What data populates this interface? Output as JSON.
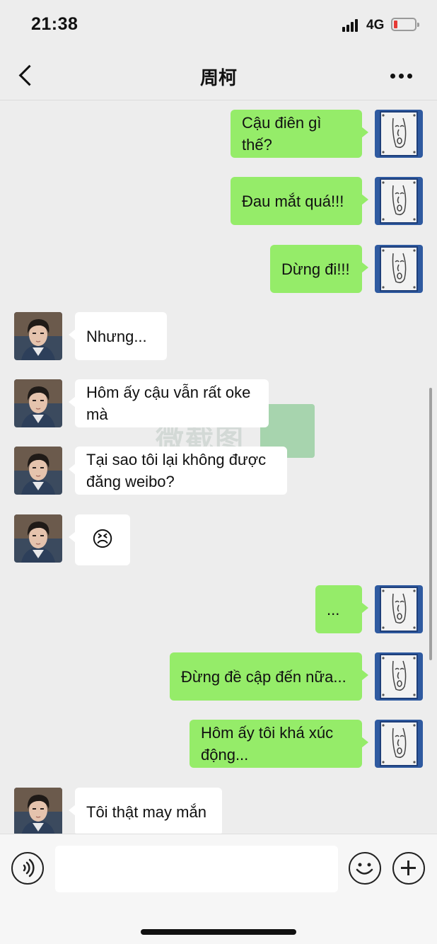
{
  "status_bar": {
    "time": "21:38",
    "network": "4G",
    "battery_color": "#e53935"
  },
  "nav": {
    "title": "周柯"
  },
  "messages": [
    {
      "from": "me",
      "text": "Cậu điên  gì thế?"
    },
    {
      "from": "me",
      "text": "Đau mắt quá!!!"
    },
    {
      "from": "me",
      "text": "Dừng đi!!!"
    },
    {
      "from": "them",
      "text": "Nhưng..."
    },
    {
      "from": "them",
      "text": "Hôm ấy cậu vẫn rất oke\nmà"
    },
    {
      "from": "them",
      "text": "Tại sao tôi lại không được\nđăng weibo?"
    },
    {
      "from": "them",
      "text": "😣",
      "is_emoji": true
    },
    {
      "from": "me",
      "text": "..."
    },
    {
      "from": "me",
      "text": "Đừng đề cập đến nữa..."
    },
    {
      "from": "me",
      "text": "Hôm ấy tôi khá xúc\nđộng..."
    },
    {
      "from": "them",
      "text": "Tôi thật may mắn"
    }
  ],
  "colors": {
    "sent_bubble": "#95ec69",
    "received_bubble": "#ffffff",
    "background": "#ededed"
  },
  "input": {
    "placeholder": ""
  },
  "icons": {
    "voice": "voice-icon",
    "emoji": "emoji-icon",
    "plus": "plus-icon",
    "back": "back-icon",
    "more": "more-icon"
  }
}
